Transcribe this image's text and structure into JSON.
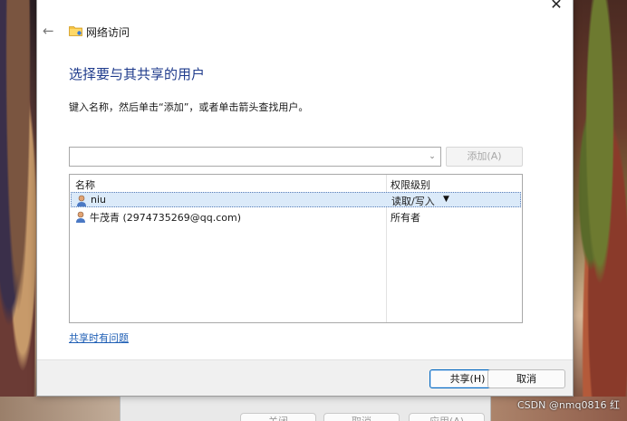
{
  "window": {
    "title": "网络访问",
    "close_glyph": "✕",
    "back_glyph": "←"
  },
  "main": {
    "heading": "选择要与其共享的用户",
    "instruction": "键入名称，然后单击“添加”，或者单击箭头查找用户。",
    "combo_value": "",
    "add_button": "添加(A)"
  },
  "list": {
    "columns": [
      "名称",
      "权限级别"
    ],
    "rows": [
      {
        "name": "niu",
        "permission": "读取/写入",
        "selected": true,
        "has_dropdown": true
      },
      {
        "name": "牛茂青 (2974735269@qq.com)",
        "permission": "所有者",
        "selected": false,
        "has_dropdown": false
      }
    ]
  },
  "help_link": "共享时有问题",
  "footer": {
    "share_button": "共享(H)",
    "cancel_button": "取消"
  },
  "background": {
    "behind_buttons": [
      "关闭",
      "取消",
      "应用(A)"
    ],
    "watermark": "CSDN @nmq0816 红"
  },
  "colors": {
    "heading": "#1f3b8c",
    "link": "#1f5fb5",
    "selection": "#dbeaf9"
  },
  "icons": [
    "back-arrow-icon",
    "folder-icon",
    "close-icon",
    "chevron-down-icon",
    "user-icon"
  ]
}
